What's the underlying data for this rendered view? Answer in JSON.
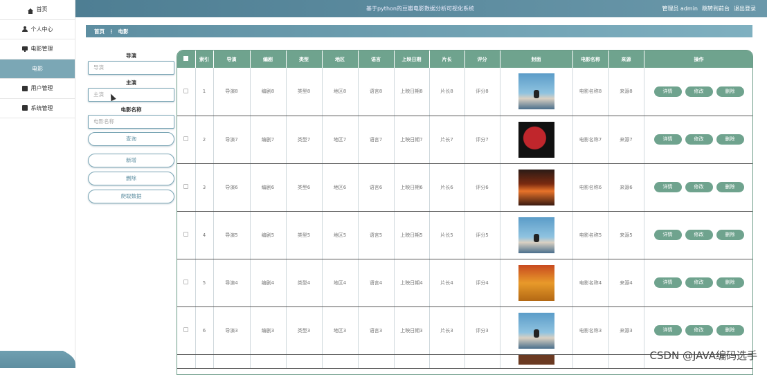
{
  "sidebar": {
    "items": [
      {
        "label": "首页",
        "icon": "home-icon"
      },
      {
        "label": "个人中心",
        "icon": "user-icon"
      },
      {
        "label": "电影管理",
        "icon": "monitor-icon"
      },
      {
        "label": "电影",
        "icon": "",
        "active": true
      },
      {
        "label": "用户管理",
        "icon": "clipboard-icon"
      },
      {
        "label": "系统管理",
        "icon": "clipboard-icon"
      }
    ]
  },
  "topbar": {
    "title": "基于python的豆瓣电影数据分析可视化系统",
    "admin_label": "管理员 admin",
    "goto_front": "跳转到前台",
    "logout": "退出登录"
  },
  "breadcrumb": {
    "home": "首页",
    "separator": "⋮",
    "current": "电影"
  },
  "search": {
    "director_label": "导演",
    "director_placeholder": "导演",
    "actor_label": "主演",
    "actor_placeholder": "主演",
    "name_label": "电影名称",
    "name_placeholder": "电影名称",
    "query_button": "查询",
    "add_button": "新增",
    "delete_button": "删除",
    "crawl_button": "爬取数据"
  },
  "table": {
    "headers": [
      "索引",
      "导演",
      "编剧",
      "类型",
      "地区",
      "语言",
      "上映日期",
      "片长",
      "评分",
      "封面",
      "电影名称",
      "来源",
      "操作"
    ],
    "actions": {
      "detail": "详情",
      "edit": "修改",
      "delete": "删除"
    },
    "rows": [
      {
        "index": "1",
        "director": "导演8",
        "writer": "编剧8",
        "type": "类型8",
        "region": "地区8",
        "language": "语言8",
        "release": "上映日期8",
        "length": "片长8",
        "score": "评分8",
        "cover": "sky",
        "name": "电影名称8",
        "source": "来源8"
      },
      {
        "index": "2",
        "director": "导演7",
        "writer": "编剧7",
        "type": "类型7",
        "region": "地区7",
        "language": "语言7",
        "release": "上映日期7",
        "length": "片长7",
        "score": "评分7",
        "cover": "spider",
        "name": "电影名称7",
        "source": "来源7"
      },
      {
        "index": "3",
        "director": "导演6",
        "writer": "编剧6",
        "type": "类型6",
        "region": "地区6",
        "language": "语言6",
        "release": "上映日期6",
        "length": "片长6",
        "score": "评分6",
        "cover": "fire",
        "name": "电影名称6",
        "source": "来源6"
      },
      {
        "index": "4",
        "director": "导演5",
        "writer": "编剧5",
        "type": "类型5",
        "region": "地区5",
        "language": "语言5",
        "release": "上映日期5",
        "length": "片长5",
        "score": "评分5",
        "cover": "sky",
        "name": "电影名称5",
        "source": "来源5"
      },
      {
        "index": "5",
        "director": "导演4",
        "writer": "编剧4",
        "type": "类型4",
        "region": "地区4",
        "language": "语言4",
        "release": "上映日期4",
        "length": "片长4",
        "score": "评分4",
        "cover": "lion",
        "name": "电影名称4",
        "source": "来源4"
      },
      {
        "index": "6",
        "director": "导演3",
        "writer": "编剧3",
        "type": "类型3",
        "region": "地区3",
        "language": "语言3",
        "release": "上映日期3",
        "length": "片长3",
        "score": "评分3",
        "cover": "sky",
        "name": "电影名称3",
        "source": "来源3"
      }
    ]
  },
  "watermark": "CSDN @JAVA编码选手",
  "colors": {
    "accent": "#6fa38e",
    "topbar": "#5a8ba0",
    "active": "#7ba7b5"
  }
}
